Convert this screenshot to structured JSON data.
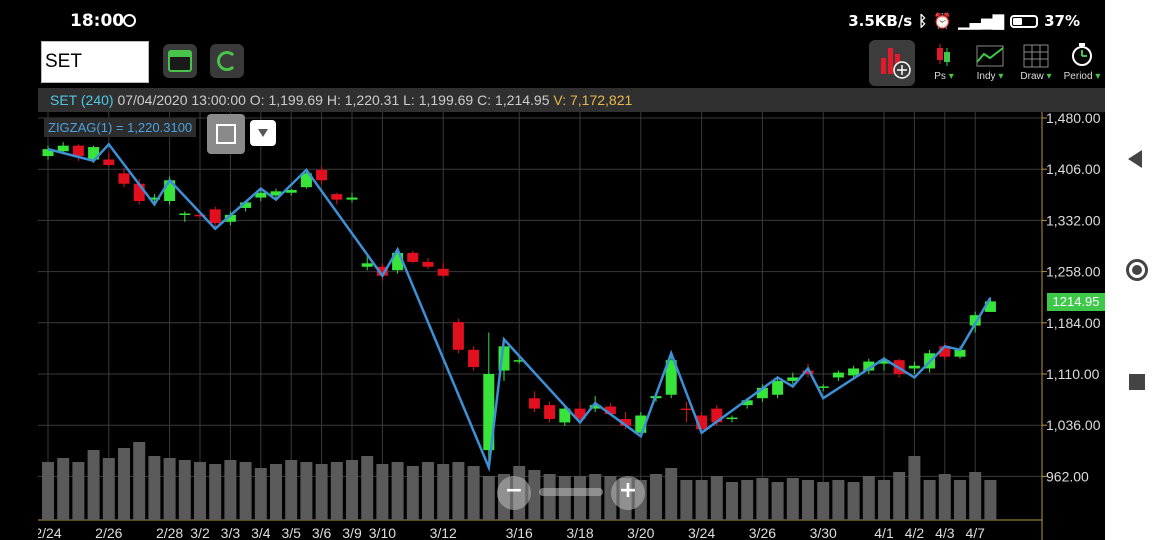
{
  "status_bar": {
    "time": "18:00",
    "network_speed": "3.5KB/s",
    "battery": "37%"
  },
  "toolbar": {
    "symbol": "SET",
    "tools": [
      {
        "label": "Ps"
      },
      {
        "label": "Indy"
      },
      {
        "label": "Draw"
      },
      {
        "label": "Period"
      }
    ]
  },
  "info": {
    "symbol": "SET (240)",
    "datetime": "07/04/2020 13:00:00",
    "open_label": "O:",
    "open": "1,199.69",
    "high_label": "H:",
    "high": "1,220.31",
    "low_label": "L:",
    "low": "1,199.69",
    "close_label": "C:",
    "close": "1,214.95",
    "volume_label": "V:",
    "volume": "7,172,821"
  },
  "indicator": {
    "label": "ZIGZAG(1) = 1,220.3100"
  },
  "last_price": "1214.95",
  "chart_data": {
    "type": "candlestick",
    "y_ticks": [
      "1,480.00",
      "1,406.00",
      "1,332.00",
      "1,258.00",
      "1,184.00",
      "1,110.00",
      "1,036.00",
      "962.00"
    ],
    "y_tick_values": [
      1480,
      1406,
      1332,
      1258,
      1184,
      1110,
      1036,
      962
    ],
    "x_labels": [
      "2/24",
      "2/26",
      "2/28",
      "3/2",
      "3/3",
      "3/4",
      "3/5",
      "3/6",
      "3/9",
      "3/10",
      "3/12",
      "3/16",
      "3/18",
      "3/20",
      "3/24",
      "3/26",
      "3/30",
      "4/1",
      "4/2",
      "4/3",
      "4/7"
    ],
    "x_label_index": [
      0,
      4,
      8,
      10,
      12,
      14,
      16,
      18,
      20,
      22,
      26,
      31,
      35,
      39,
      43,
      47,
      51,
      55,
      57,
      59,
      61
    ],
    "candles": [
      [
        1425,
        1440,
        1420,
        1435
      ],
      [
        1432,
        1445,
        1428,
        1440
      ],
      [
        1440,
        1442,
        1418,
        1425
      ],
      [
        1420,
        1440,
        1415,
        1438
      ],
      [
        1420,
        1430,
        1410,
        1412
      ],
      [
        1400,
        1408,
        1380,
        1385
      ],
      [
        1385,
        1392,
        1355,
        1360
      ],
      [
        1362,
        1370,
        1355,
        1365
      ],
      [
        1360,
        1395,
        1355,
        1390
      ],
      [
        1340,
        1345,
        1330,
        1342
      ],
      [
        1340,
        1345,
        1335,
        1338
      ],
      [
        1348,
        1352,
        1322,
        1328
      ],
      [
        1330,
        1345,
        1325,
        1340
      ],
      [
        1350,
        1360,
        1345,
        1358
      ],
      [
        1365,
        1378,
        1360,
        1372
      ],
      [
        1368,
        1378,
        1362,
        1374
      ],
      [
        1372,
        1378,
        1368,
        1376
      ],
      [
        1380,
        1405,
        1378,
        1400
      ],
      [
        1405,
        1410,
        1385,
        1390
      ],
      [
        1370,
        1372,
        1355,
        1362
      ],
      [
        1362,
        1372,
        1358,
        1365
      ],
      [
        1265,
        1280,
        1260,
        1270
      ],
      [
        1265,
        1270,
        1245,
        1252
      ],
      [
        1260,
        1290,
        1255,
        1285
      ],
      [
        1285,
        1288,
        1270,
        1272
      ],
      [
        1272,
        1278,
        1262,
        1265
      ],
      [
        1262,
        1270,
        1250,
        1252
      ],
      [
        1185,
        1190,
        1140,
        1145
      ],
      [
        1145,
        1150,
        1115,
        1120
      ],
      [
        1000,
        1170,
        975,
        1110
      ],
      [
        1115,
        1160,
        1100,
        1150
      ],
      [
        1130,
        1135,
        1125,
        1130
      ],
      [
        1075,
        1085,
        1055,
        1060
      ],
      [
        1065,
        1070,
        1040,
        1045
      ],
      [
        1040,
        1065,
        1035,
        1060
      ],
      [
        1060,
        1070,
        1040,
        1045
      ],
      [
        1060,
        1078,
        1055,
        1065
      ],
      [
        1063,
        1068,
        1050,
        1052
      ],
      [
        1045,
        1055,
        1030,
        1035
      ],
      [
        1025,
        1055,
        1020,
        1050
      ],
      [
        1075,
        1080,
        1070,
        1078
      ],
      [
        1080,
        1140,
        1075,
        1130
      ],
      [
        1060,
        1070,
        1040,
        1058
      ],
      [
        1050,
        1055,
        1025,
        1030
      ],
      [
        1060,
        1065,
        1035,
        1040
      ],
      [
        1045,
        1050,
        1040,
        1047
      ],
      [
        1065,
        1075,
        1060,
        1072
      ],
      [
        1075,
        1095,
        1070,
        1090
      ],
      [
        1080,
        1105,
        1075,
        1100
      ],
      [
        1100,
        1112,
        1095,
        1105
      ],
      [
        1115,
        1125,
        1105,
        1110
      ],
      [
        1090,
        1095,
        1085,
        1092
      ],
      [
        1105,
        1115,
        1100,
        1112
      ],
      [
        1108,
        1122,
        1105,
        1118
      ],
      [
        1115,
        1132,
        1110,
        1128
      ],
      [
        1125,
        1135,
        1115,
        1130
      ],
      [
        1130,
        1132,
        1105,
        1110
      ],
      [
        1118,
        1128,
        1110,
        1122
      ],
      [
        1118,
        1145,
        1112,
        1140
      ],
      [
        1150,
        1155,
        1130,
        1135
      ],
      [
        1135,
        1150,
        1132,
        1145
      ],
      [
        1180,
        1200,
        1170,
        1195
      ],
      [
        1199.69,
        1220.31,
        1199.69,
        1214.95
      ]
    ],
    "zigzag": [
      [
        0,
        1435
      ],
      [
        3,
        1418
      ],
      [
        4,
        1442
      ],
      [
        7,
        1355
      ],
      [
        8,
        1390
      ],
      [
        11,
        1320
      ],
      [
        14,
        1378
      ],
      [
        15,
        1362
      ],
      [
        17,
        1405
      ],
      [
        22,
        1252
      ],
      [
        23,
        1290
      ],
      [
        29,
        975
      ],
      [
        30,
        1160
      ],
      [
        35,
        1040
      ],
      [
        36,
        1068
      ],
      [
        39,
        1020
      ],
      [
        41,
        1140
      ],
      [
        43,
        1025
      ],
      [
        48,
        1105
      ],
      [
        49,
        1092
      ],
      [
        50,
        1118
      ],
      [
        51,
        1075
      ],
      [
        55,
        1132
      ],
      [
        57,
        1105
      ],
      [
        59,
        1150
      ],
      [
        60,
        1145
      ],
      [
        62,
        1220.31
      ]
    ],
    "volume": [
      58,
      62,
      58,
      70,
      62,
      72,
      78,
      64,
      62,
      60,
      58,
      56,
      60,
      58,
      52,
      56,
      60,
      58,
      56,
      58,
      60,
      64,
      56,
      58,
      54,
      58,
      56,
      58,
      54,
      44,
      46,
      54,
      50,
      46,
      44,
      44,
      46,
      44,
      42,
      40,
      46,
      52,
      40,
      40,
      44,
      38,
      40,
      42,
      38,
      42,
      40,
      38,
      40,
      38,
      44,
      40,
      48,
      64,
      40,
      46,
      40,
      48,
      40
    ],
    "volume_max": 80
  }
}
